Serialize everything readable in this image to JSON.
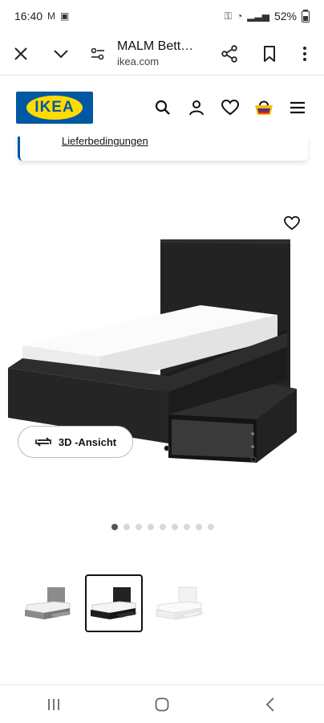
{
  "status_bar": {
    "time": "16:40",
    "battery": "52%"
  },
  "browser": {
    "title": "MALM Bett…",
    "domain": "ikea.com"
  },
  "site": {
    "logo_text": "IKEA"
  },
  "notice": {
    "link_text": "Lieferbedingungen"
  },
  "gallery": {
    "button_3d_label": "3D -Ansicht",
    "total_images": 9,
    "active_index": 0
  },
  "thumbnails": [
    {
      "variant": "grey"
    },
    {
      "variant": "black-brown",
      "selected": true
    },
    {
      "variant": "white"
    }
  ],
  "colors": {
    "brand_blue": "#0058a3",
    "brand_yellow": "#ffdb00",
    "bed_dark": "#1e1e1e",
    "mattress": "#f4f4f4"
  }
}
